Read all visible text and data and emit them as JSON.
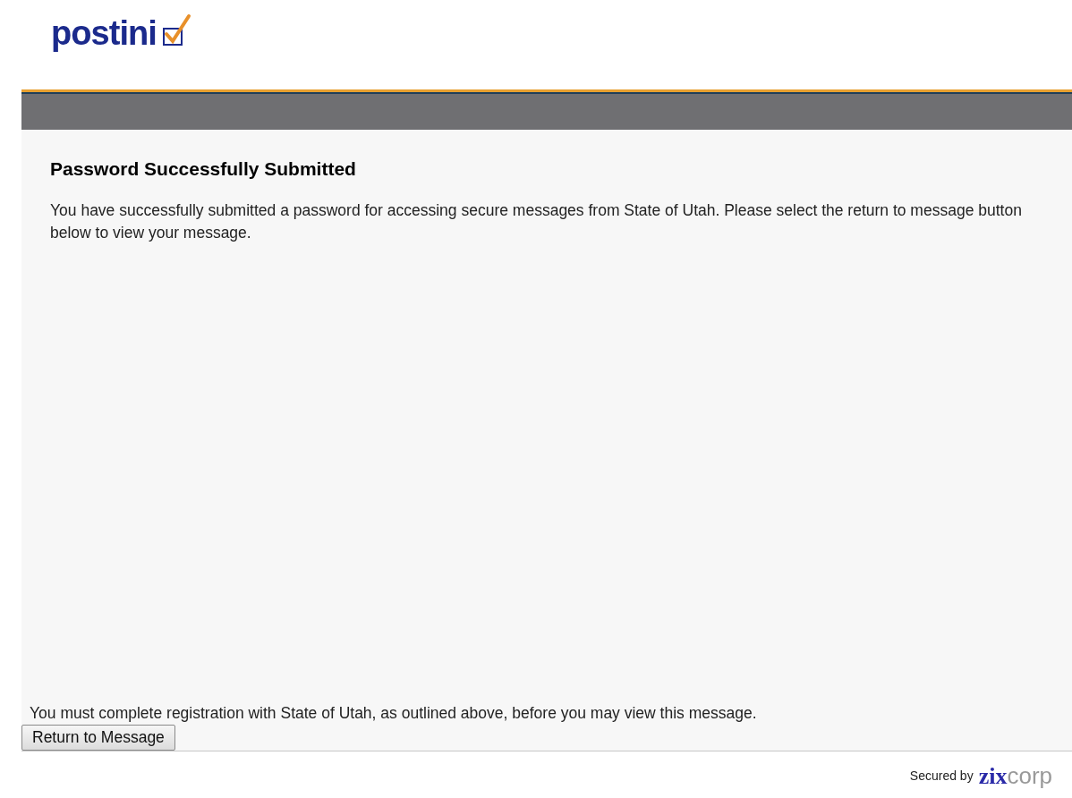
{
  "logo": {
    "name": "postini"
  },
  "heading": "Password Successfully Submitted",
  "message": "You have successfully submitted a password for accessing secure messages from State of Utah. Please select the return to message button below to view your message.",
  "notice": "You must complete registration with State of Utah, as outlined above, before you may view this message.",
  "button": "Return to Message",
  "footer": {
    "secured_by": "Secured by",
    "brand_bold": "zix",
    "brand_light": "corp"
  }
}
